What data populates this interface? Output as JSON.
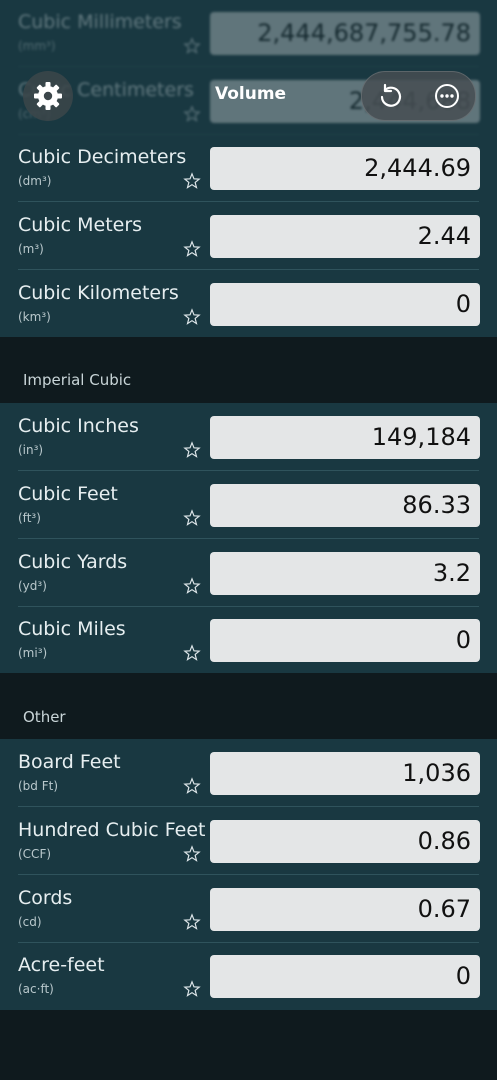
{
  "header": {
    "title": "Volume",
    "settings_icon": "gear-icon",
    "undo_icon": "undo-icon",
    "more_icon": "more-icon"
  },
  "sections": [
    {
      "title": "",
      "rows": [
        {
          "label": "Cubic Millimeters",
          "unit": "(mm³)",
          "value": "2,444,687,755.78"
        },
        {
          "label": "Cubic Centimeters",
          "unit": "(cm³)",
          "value": "2,444,688"
        },
        {
          "label": "Cubic Decimeters",
          "unit": "(dm³)",
          "value": "2,444.69"
        },
        {
          "label": "Cubic Meters",
          "unit": "(m³)",
          "value": "2.44"
        },
        {
          "label": "Cubic Kilometers",
          "unit": "(km³)",
          "value": "0"
        }
      ]
    },
    {
      "title": "Imperial Cubic",
      "rows": [
        {
          "label": "Cubic Inches",
          "unit": "(in³)",
          "value": "149,184"
        },
        {
          "label": "Cubic Feet",
          "unit": "(ft³)",
          "value": "86.33"
        },
        {
          "label": "Cubic Yards",
          "unit": "(yd³)",
          "value": "3.2"
        },
        {
          "label": "Cubic Miles",
          "unit": "(mi³)",
          "value": "0"
        }
      ]
    },
    {
      "title": "Other",
      "rows": [
        {
          "label": "Board Feet",
          "unit": "(bd Ft)",
          "value": "1,036"
        },
        {
          "label": "Hundred Cubic Feet",
          "unit": "(CCF)",
          "value": "0.86"
        },
        {
          "label": "Cords",
          "unit": "(cd)",
          "value": "0.67"
        },
        {
          "label": "Acre-feet",
          "unit": "(ac·ft)",
          "value": "0"
        }
      ]
    }
  ],
  "colors": {
    "row_background": "#193841",
    "page_background": "#0f1a1e",
    "field_background": "#e4e6e7"
  }
}
